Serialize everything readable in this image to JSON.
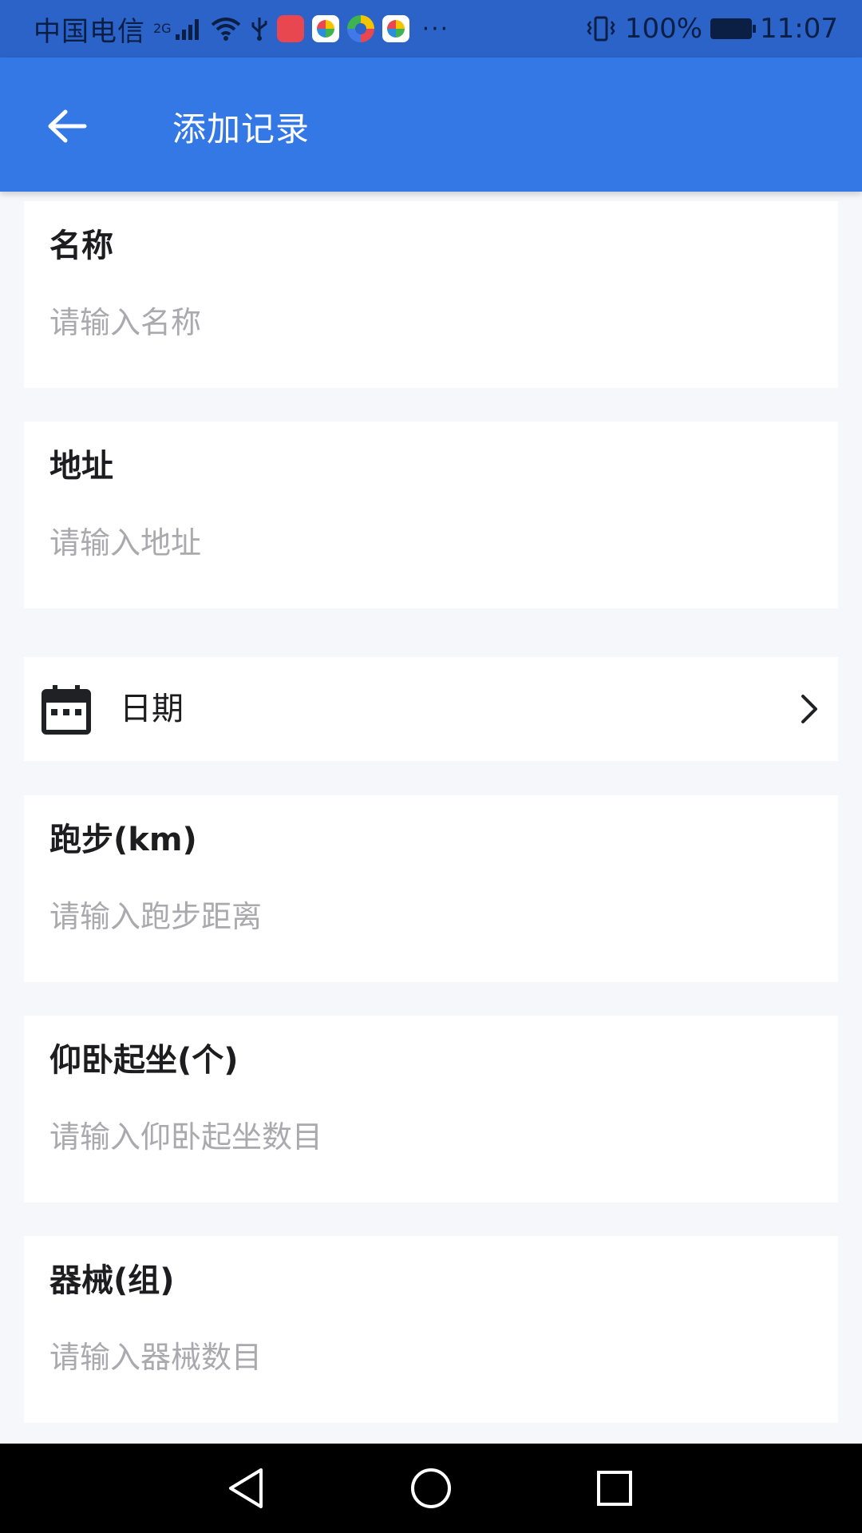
{
  "status_bar": {
    "carrier": "中国电信",
    "network_type": "2G",
    "battery": "100%",
    "time": "11:07",
    "overflow": "···"
  },
  "app_bar": {
    "title": "添加记录",
    "back_icon": "arrow-left-icon",
    "color": "#3478e5"
  },
  "form": {
    "name": {
      "label": "名称",
      "placeholder": "请输入名称",
      "value": ""
    },
    "address": {
      "label": "地址",
      "placeholder": "请输入地址",
      "value": ""
    },
    "date": {
      "label": "日期",
      "icon": "calendar-icon",
      "chevron_icon": "chevron-right-icon"
    },
    "running": {
      "label": "跑步(km)",
      "placeholder": "请输入跑步距离",
      "value": ""
    },
    "situps": {
      "label": "仰卧起坐(个)",
      "placeholder": "请输入仰卧起坐数目",
      "value": ""
    },
    "equipment": {
      "label": "器械(组)",
      "placeholder": "请输入器械数目",
      "value": ""
    }
  },
  "nav_bar": {
    "back_icon": "triangle-back-icon",
    "home_icon": "circle-home-icon",
    "recents_icon": "square-recents-icon"
  },
  "colors": {
    "status_bar": "#2b63c8",
    "background": "#f6f7fb",
    "placeholder": "#a9a9ae"
  }
}
